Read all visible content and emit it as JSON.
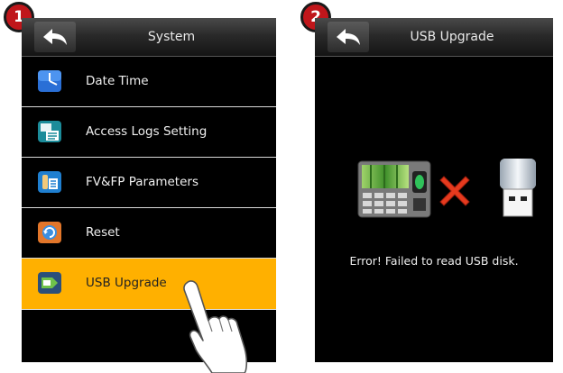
{
  "steps": {
    "step1": "1",
    "step2": "2"
  },
  "screen1": {
    "title": "System",
    "items": [
      {
        "label": "Date Time",
        "icon": "clock-icon"
      },
      {
        "label": "Access Logs Setting",
        "icon": "access-logs-icon"
      },
      {
        "label": "FV&FP Parameters",
        "icon": "fv-fp-parameters-icon"
      },
      {
        "label": "Reset",
        "icon": "reset-icon"
      },
      {
        "label": "USB Upgrade",
        "icon": "usb-upgrade-icon",
        "selected": true
      }
    ]
  },
  "screen2": {
    "title": "USB Upgrade",
    "error_message": "Error! Failed to read USB disk."
  },
  "colors": {
    "selected_bg": "#ffb000",
    "badge": "#c0161b",
    "screen_bg": "#000000"
  }
}
